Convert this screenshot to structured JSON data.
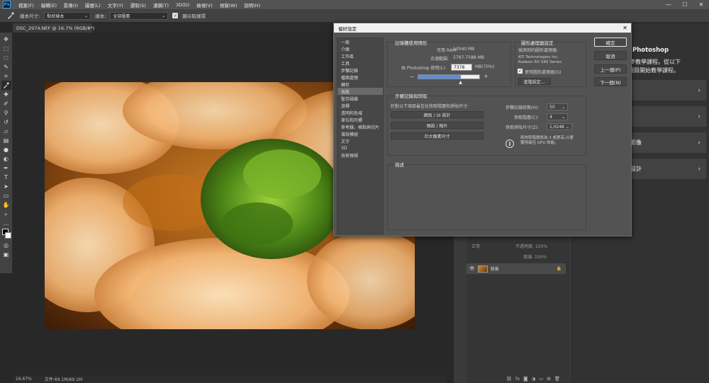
{
  "menu": {
    "logo": "Ps",
    "items": [
      "檔案(F)",
      "編輯(E)",
      "影像(I)",
      "圖層(L)",
      "文字(Y)",
      "選取(S)",
      "濾鏡(T)",
      "3D(D)",
      "檢視(V)",
      "視窗(W)",
      "說明(H)"
    ],
    "minimize": "—",
    "maximize": "☐",
    "close": "✕"
  },
  "options": {
    "tool_icon": "eyedropper-icon",
    "sample_size_label": "樣本尺寸:",
    "sample_size_value": "點狀樣本",
    "sample_label": "樣本:",
    "sample_value": "全部圖層",
    "show_ring_label": "顯示取樣環",
    "show_ring_checked": "✓"
  },
  "document": {
    "tab_title": "DSC_2974.NEF @ 16.7% (RGB/8*)",
    "zoom": "16.67%",
    "doc_info": "文件:69.1M/69.1M"
  },
  "learn_panel": {
    "title_fragment": "Photoshop",
    "desc_line1": "的逐步教學課程。從以下",
    "desc_line2": "項目開始教學課程。",
    "items": [
      "",
      "",
      "影像",
      "設計"
    ]
  },
  "layers": {
    "blend": "正常",
    "opacity_label": "不透明度:",
    "opacity": "100%",
    "fill_label": "填滿:",
    "fill": "100%",
    "layer_name": "背景"
  },
  "dialog": {
    "title": "偏好設定",
    "close": "✕",
    "categories": [
      "一般",
      "介面",
      "工作區",
      "工具",
      "步驟記錄",
      "檔案處理",
      "轉存",
      "效能",
      "暫存磁碟",
      "游標",
      "透明和色域",
      "單位和尺標",
      "參考線、格點與切片",
      "增效模組",
      "文字",
      "3D",
      "技術預視"
    ],
    "selected_category": "效能",
    "memory": {
      "title": "記憶體使用情形",
      "available_label": "可用 RAM:",
      "available_value": "10540 MB",
      "ideal_label": "合適範圍:",
      "ideal_value": "5797-7588 MB",
      "let_use_label": "由 Photoshop 使用(L):",
      "let_use_value": "7378",
      "let_use_unit": "MB(70%)",
      "slider_fraction": 0.7,
      "minus": "−",
      "plus": "+"
    },
    "gpu": {
      "title": "圖形處理器設定",
      "detected_label": "偵測到的圖形處理器:",
      "vendor": "ATI Technologies Inc.",
      "model": "Radeon RX 580 Series",
      "use_gpu_label": "使用圖形處理器(G)",
      "use_gpu_checked": "✓",
      "advanced_button": "進階設定..."
    },
    "history": {
      "title": "步驟記錄與快取",
      "optimize_label": "針對以下項目最佳化快取階層和拼貼尺寸:",
      "preset_buttons": [
        "網頁 / UI 設計",
        "預設 / 相片",
        "巨大像素尺寸"
      ],
      "states_label": "步驟記錄狀態(H):",
      "states_value": "50",
      "cache_levels_label": "快取階層(C):",
      "cache_levels_value": "4",
      "tile_size_label": "快取拼貼尺寸(Z):",
      "tile_size_value": "1,024K",
      "info_line1": "將快取階層設為 2 或更高,以便",
      "info_line2": "獲得最佳 GPU 效能。"
    },
    "description": {
      "title": "描述"
    },
    "buttons": {
      "ok": "確定",
      "cancel": "取消",
      "prev": "上一個(P)",
      "next": "下一個(N)"
    }
  }
}
